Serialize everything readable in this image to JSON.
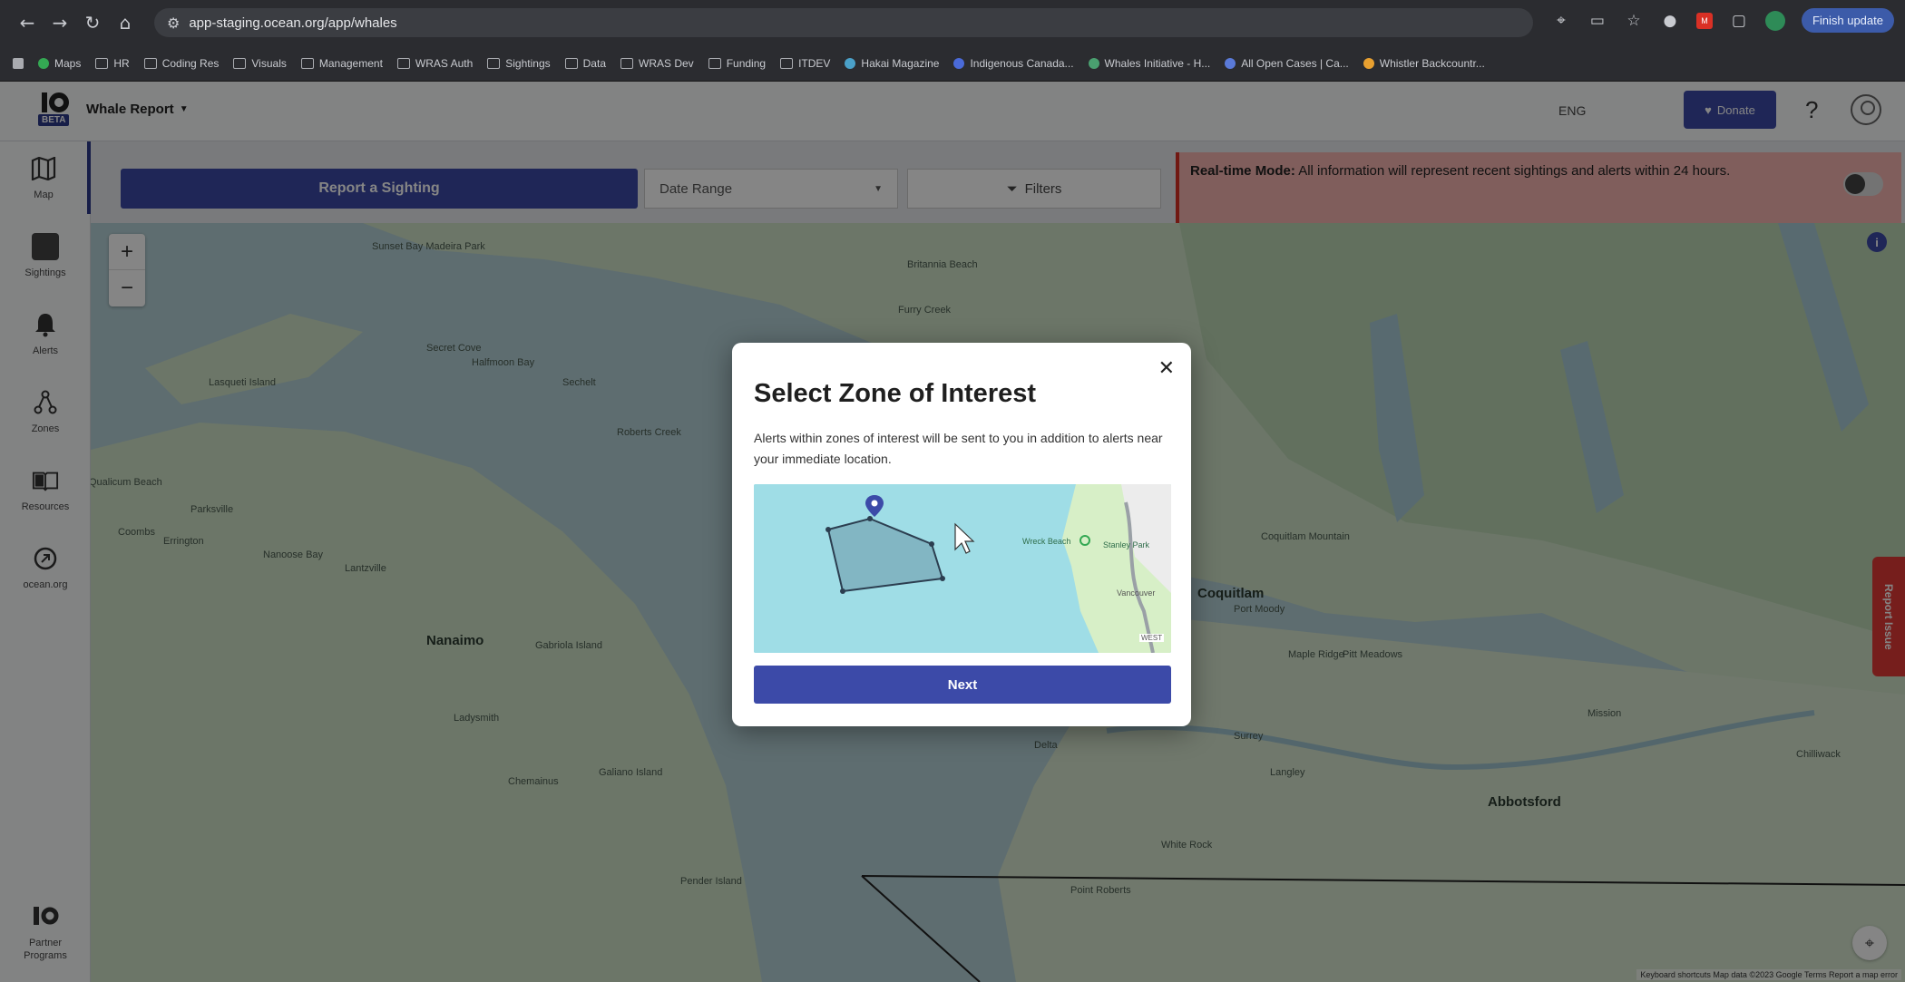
{
  "browser": {
    "url": "app-staging.ocean.org/app/whales",
    "finish_update": "Finish update",
    "bookmarks": [
      "Maps",
      "HR",
      "Coding Res",
      "Visuals",
      "Management",
      "WRAS Auth",
      "Sightings",
      "Data",
      "WRAS Dev",
      "Funding",
      "ITDEV",
      "Hakai Magazine",
      "Indigenous Canada...",
      "Whales Initiative - H...",
      "All Open Cases | Ca...",
      "Whistler Backcountr..."
    ]
  },
  "header": {
    "app_title": "Whale Report",
    "beta": "BETA",
    "lang": "ENG",
    "donate": "Donate",
    "help": "?"
  },
  "sidebar": {
    "items": [
      {
        "label": "Map",
        "icon": "map-icon"
      },
      {
        "label": "Sightings",
        "icon": "sightings-icon"
      },
      {
        "label": "Alerts",
        "icon": "bell-icon"
      },
      {
        "label": "Zones",
        "icon": "zones-icon"
      },
      {
        "label": "Resources",
        "icon": "book-icon"
      },
      {
        "label": "ocean.org",
        "icon": "link-icon"
      },
      {
        "label": "Partner Programs",
        "icon": "partner-icon"
      }
    ]
  },
  "toolbar": {
    "report_sighting": "Report a Sighting",
    "date_range": "Date Range",
    "filters": "Filters"
  },
  "banner": {
    "title": "Real-time Mode:",
    "text": "All information will represent recent sightings and alerts within 24 hours."
  },
  "map": {
    "labels": [
      "Sunset Bay Madeira Park",
      "Secret Cove",
      "Halfmoon Bay",
      "Sechelt",
      "Roberts Creek",
      "Lasqueti Island",
      "Qualicum Beach",
      "Parksville",
      "Coombs",
      "Errington",
      "Nanoose Bay",
      "Lantzville",
      "Nanaimo",
      "Gabriola Island",
      "Ladysmith",
      "Chemainus",
      "Galiano Island",
      "Pender Island",
      "Delta",
      "Coquitlam",
      "Langley",
      "Abbotsford",
      "Maple Ridge",
      "Mission",
      "Chilliwack",
      "White Rock",
      "Point Roberts",
      "Surrey",
      "Pitt Meadows",
      "Coquitlam Mountain",
      "Furry Creek",
      "Britannia Beach",
      "Port Moody"
    ],
    "report_issue": "Report Issue",
    "attribution": "Keyboard shortcuts   Map data ©2023 Google   Terms   Report a map error"
  },
  "modal": {
    "title": "Select Zone of Interest",
    "description": "Alerts within zones of interest will be sent to you in addition to alerts near your immediate location.",
    "next": "Next",
    "preview_labels": [
      "Wreck Beach",
      "Stanley Park",
      "Vancouver",
      "WEST"
    ]
  }
}
